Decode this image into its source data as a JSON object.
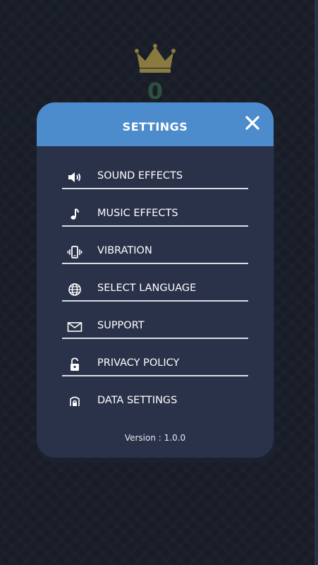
{
  "score": {
    "value": "0"
  },
  "settings": {
    "title": "SETTINGS",
    "items": [
      {
        "label": "SOUND EFFECTS",
        "icon": "speaker-icon"
      },
      {
        "label": "MUSIC EFFECTS",
        "icon": "music-note-icon"
      },
      {
        "label": "VIBRATION",
        "icon": "vibration-icon"
      },
      {
        "label": "SELECT LANGUAGE",
        "icon": "globe-icon"
      },
      {
        "label": "SUPPORT",
        "icon": "envelope-icon"
      },
      {
        "label": "PRIVACY POLICY",
        "icon": "lock-icon"
      },
      {
        "label": "DATA SETTINGS",
        "icon": "data-lock-icon"
      }
    ],
    "version": "Version : 1.0.0"
  },
  "colors": {
    "header": "#4d8ccc",
    "dialog": "#2a3249",
    "background": "#171c27",
    "crown": "#8a7a3f"
  }
}
